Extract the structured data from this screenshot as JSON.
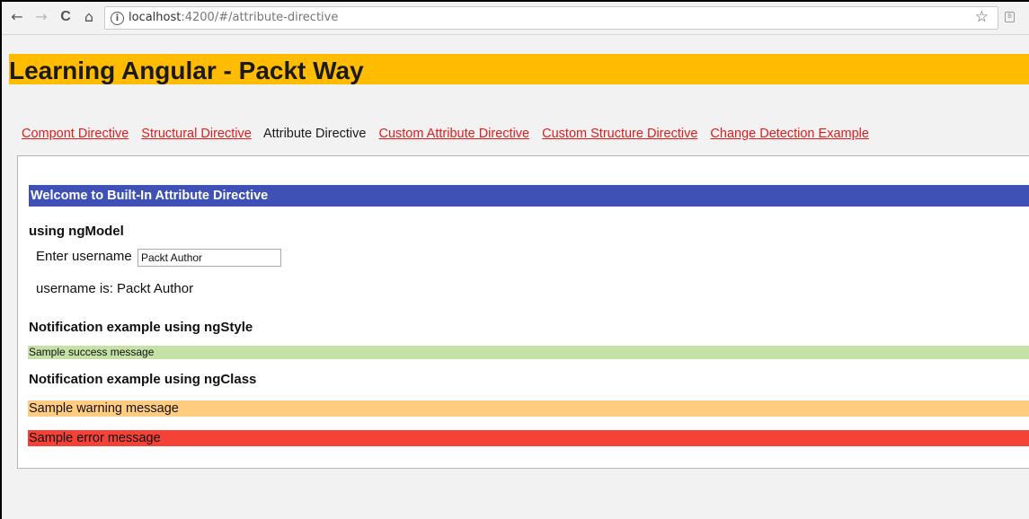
{
  "browser": {
    "url_host": "localhost",
    "url_path": ":4200/#/attribute-directive",
    "back_icon": "←",
    "forward_icon": "→",
    "reload_icon": "C",
    "home_icon": "⌂",
    "info_icon": "i",
    "star_icon": "☆",
    "ext_icon": "B"
  },
  "header": {
    "title": "Learning Angular - Packt Way"
  },
  "nav": {
    "links": [
      "Compont Directive",
      "Structural Directive",
      "Attribute Directive",
      "Custom Attribute Directive",
      "Custom Structure Directive",
      "Change Detection Example"
    ],
    "active_index": 2
  },
  "panel": {
    "welcome": "Welcome to Built-In Attribute Directive",
    "ngmodel_heading": "using ngModel",
    "username_label": "Enter username",
    "username_value": "Packt Author",
    "username_display": "username is: Packt Author",
    "ngstyle_heading": "Notification example using ngStyle",
    "success_message": "Sample success message",
    "ngclass_heading": "Notification example using ngClass",
    "warning_message": "Sample warning message",
    "error_message": "Sample error message"
  },
  "colors": {
    "header": "#ffbc00",
    "welcome": "#3f51b5",
    "success": "#c5e1a5",
    "warning": "#ffcc80",
    "error": "#f44336",
    "link": "#e41b1b"
  }
}
